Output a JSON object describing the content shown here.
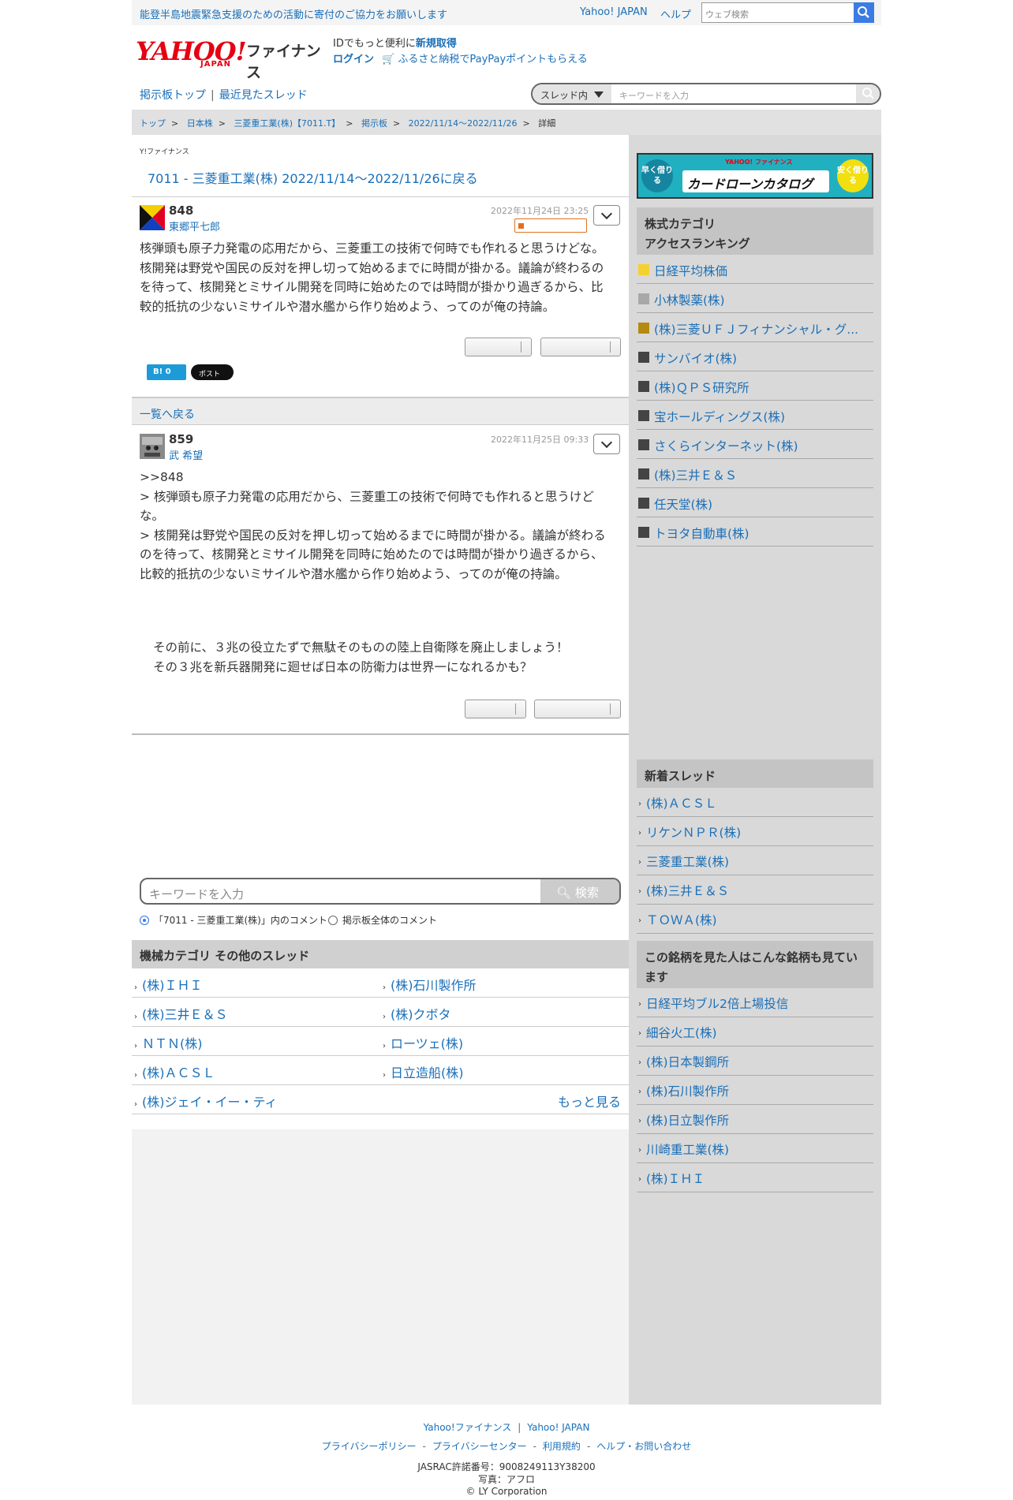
{
  "topbar": {
    "notice": "能登半島地震緊急支援のための活動に寄付のご協力をお願いします",
    "yahoo_japan": "Yahoo! JAPAN",
    "help": "ヘルプ",
    "search_placeholder": "ウェブ検索"
  },
  "header": {
    "logo_text": "YAHOO!",
    "logo_sub": "JAPAN",
    "logo_service": "ファイナンス",
    "id_text": "IDでもっと便利に",
    "signup": "新規取得",
    "login": "ログイン",
    "furusato": "ふるさと納税でPayPayポイントもらえる"
  },
  "subnav": {
    "board_top": "掲示板トップ",
    "recent": "最近見たスレッド",
    "scope": "スレッド内",
    "keyword_placeholder": "キーワードを入力"
  },
  "breadcrumb": [
    "トップ",
    "日本株",
    "三菱重工業(株)【7011.T】",
    "掲示板",
    "2022/11/14〜2022/11/26",
    "詳細"
  ],
  "mini_logo": "Y!ファイナンス",
  "back_link": "7011 - 三菱重工業(株) 2022/11/14〜2022/11/26に戻る",
  "post1": {
    "number": "848",
    "author": "東郷平七郎",
    "date": "2022年11月24日 23:25",
    "text": "核弾頭も原子力発電の応用だから、三菱重工の技術で何時でも作れると思うけどな。\n核開発は野党や国民の反対を押し切って始めるまでに時間が掛かる。議論が終わるの\nを待って、核開発とミサイル開発を同時に始めたのでは時間が掛かり過ぎるから、比\n較的抵抗の少ないミサイルや潜水艦から作り始めよう、ってのが俺の持論。",
    "hatena": "B! 0",
    "tweet": "ポスト"
  },
  "list_back": "一覧へ戻る",
  "post2": {
    "number": "859",
    "author": "武 希望",
    "date": "2022年11月25日 09:33",
    "quote": ">>848\n> 核弾頭も原子力発電の応用だから、三菱重工の技術で何時でも作れると思うけど\nな。\n> 核開発は野党や国民の反対を押し切って始めるまでに時間が掛かる。議論が終わる\nのを待って、核開発とミサイル開発を同時に始めたのでは時間が掛かり過ぎるから、\n比較的抵抗の少ないミサイルや潜水艦から作り始めよう、ってのが俺の持論。",
    "reply": "その前に、３兆の役立たずで無駄そのものの陸上自衛隊を廃止しましょう！\nその３兆を新兵器開発に廻せば日本の防衛力は世界一になれるかも？"
  },
  "bottom_search": {
    "placeholder": "キーワードを入力",
    "button": "検索",
    "radio_in_thread": "「7011 - 三菱重工業(株)」内のコメント",
    "radio_all": "掲示板全体のコメント"
  },
  "other_threads": {
    "heading": "機械カテゴリ  その他のスレッド",
    "left": [
      "(株)ＩＨＩ",
      "(株)三井Ｅ＆Ｓ",
      "ＮＴＮ(株)",
      "(株)ＡＣＳＬ",
      "(株)ジェイ・イー・ティ"
    ],
    "right": [
      "(株)石川製作所",
      "(株)クボタ",
      "ローツェ(株)",
      "日立造船(株)"
    ],
    "more": "もっと見る"
  },
  "ad": {
    "left": "早く借りる",
    "brand": "YAHOO! ファイナンス",
    "main": "カードローンカタログ",
    "right": "安く借りる"
  },
  "ranking": {
    "heading_line1": "株式カテゴリ",
    "heading_line2": "アクセスランキング",
    "items": [
      {
        "label": "日経平均株価",
        "color": "#f5d130"
      },
      {
        "label": "小林製薬(株)",
        "color": "#a8a8a8"
      },
      {
        "label": "(株)三菱ＵＦＪフィナンシャル・グ...",
        "color": "#b58a10"
      },
      {
        "label": "サンバイオ(株)",
        "color": "#444444"
      },
      {
        "label": "(株)ＱＰＳ研究所",
        "color": "#444444"
      },
      {
        "label": "宝ホールディングス(株)",
        "color": "#444444"
      },
      {
        "label": "さくらインターネット(株)",
        "color": "#444444"
      },
      {
        "label": "(株)三井Ｅ＆Ｓ",
        "color": "#444444"
      },
      {
        "label": "任天堂(株)",
        "color": "#444444"
      },
      {
        "label": "トヨタ自動車(株)",
        "color": "#444444"
      }
    ]
  },
  "new_threads": {
    "heading": "新着スレッド",
    "items": [
      "(株)ＡＣＳＬ",
      "リケンＮＰＲ(株)",
      "三菱重工業(株)",
      "(株)三井Ｅ＆Ｓ",
      "ＴＯＷＡ(株)"
    ]
  },
  "also_viewed": {
    "heading": "この銘柄を見た人はこんな銘柄も見ています",
    "items": [
      "日経平均ブル2倍上場投信",
      "細谷火工(株)",
      "(株)日本製鋼所",
      "(株)石川製作所",
      "(株)日立製作所",
      "川崎重工業(株)",
      "(株)ＩＨＩ"
    ]
  },
  "footer": {
    "yahoo_finance": "Yahoo!ファイナンス",
    "yahoo_japan": "Yahoo! JAPAN",
    "privacy_policy": "プライバシーポリシー",
    "privacy_center": "プライバシーセンター",
    "terms": "利用規約",
    "help": "ヘルプ・お問い合わせ",
    "jasrac": "JASRAC許諾番号：9008249113Y38200",
    "photo": "写真：アフロ",
    "copyright": "© LY Corporation"
  }
}
